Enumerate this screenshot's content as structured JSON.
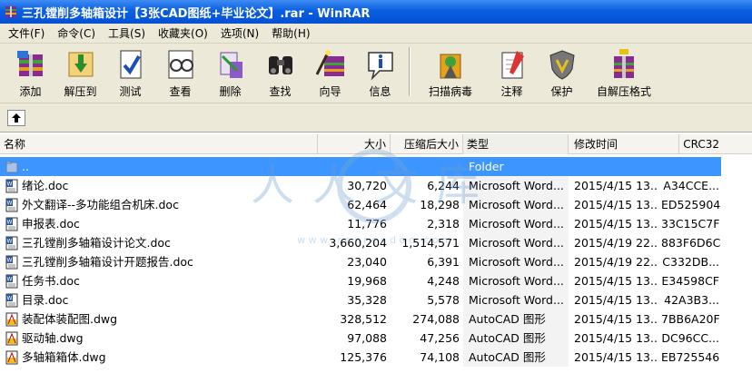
{
  "window": {
    "title": "三孔镗削多轴箱设计【3张CAD图纸+毕业论文】.rar - WinRAR"
  },
  "menu": [
    "文件(F)",
    "命令(C)",
    "工具(S)",
    "收藏夹(O)",
    "选项(N)",
    "帮助(H)"
  ],
  "toolbar": [
    {
      "label": "添加",
      "icon": "add-archive-icon"
    },
    {
      "label": "解压到",
      "icon": "extract-to-icon"
    },
    {
      "label": "测试",
      "icon": "test-icon"
    },
    {
      "label": "查看",
      "icon": "view-icon"
    },
    {
      "label": "删除",
      "icon": "delete-icon"
    },
    {
      "label": "查找",
      "icon": "find-icon"
    },
    {
      "label": "向导",
      "icon": "wizard-icon"
    },
    {
      "label": "信息",
      "icon": "info-icon"
    },
    {
      "label": "扫描病毒",
      "icon": "virus-scan-icon"
    },
    {
      "label": "注释",
      "icon": "comment-icon"
    },
    {
      "label": "保护",
      "icon": "protect-icon"
    },
    {
      "label": "自解压格式",
      "icon": "sfx-icon"
    }
  ],
  "columns": {
    "name": "名称",
    "size": "大小",
    "packed": "压缩后大小",
    "type": "类型",
    "modified": "修改时间",
    "crc": "CRC32"
  },
  "watermark": {
    "text": "人人文库",
    "url": "w w w . r e n r e n d o c . c o m"
  },
  "files": [
    {
      "name": "..",
      "size": "",
      "packed": "",
      "type": "Folder",
      "modified": "",
      "crc": "",
      "kind": "folder",
      "selected": true
    },
    {
      "name": "绪论.doc",
      "size": "30,720",
      "packed": "6,244",
      "type": "Microsoft Word...",
      "modified": "2015/4/15 13...",
      "crc": "A34CCE...",
      "kind": "doc"
    },
    {
      "name": "外文翻译--多功能组合机床.doc",
      "size": "62,464",
      "packed": "18,298",
      "type": "Microsoft Word...",
      "modified": "2015/4/15 13...",
      "crc": "ED525904",
      "kind": "doc"
    },
    {
      "name": "申报表.doc",
      "size": "11,776",
      "packed": "2,318",
      "type": "Microsoft Word...",
      "modified": "2015/4/15 13...",
      "crc": "33C15C7F",
      "kind": "doc"
    },
    {
      "name": "三孔镗削多轴箱设计论文.doc",
      "size": "3,660,204",
      "packed": "1,514,571",
      "type": "Microsoft Word...",
      "modified": "2015/4/19 22...",
      "crc": "883F6D6C",
      "kind": "doc"
    },
    {
      "name": "三孔镗削多轴箱设计开题报告.doc",
      "size": "23,040",
      "packed": "6,391",
      "type": "Microsoft Word...",
      "modified": "2015/4/19 22...",
      "crc": "C332DB...",
      "kind": "doc"
    },
    {
      "name": "任务书.doc",
      "size": "19,968",
      "packed": "4,248",
      "type": "Microsoft Word...",
      "modified": "2015/4/15 13...",
      "crc": "E34598CF",
      "kind": "doc"
    },
    {
      "name": "目录.doc",
      "size": "35,328",
      "packed": "5,578",
      "type": "Microsoft Word...",
      "modified": "2015/4/15 13...",
      "crc": "42A3B3...",
      "kind": "doc"
    },
    {
      "name": "装配体装配图.dwg",
      "size": "328,512",
      "packed": "274,088",
      "type": "AutoCAD 图形",
      "modified": "2015/4/15 13...",
      "crc": "7BB6A20F",
      "kind": "dwg"
    },
    {
      "name": "驱动轴.dwg",
      "size": "97,088",
      "packed": "47,256",
      "type": "AutoCAD 图形",
      "modified": "2015/4/15 13...",
      "crc": "DC96CC...",
      "kind": "dwg"
    },
    {
      "name": "多轴箱箱体.dwg",
      "size": "125,376",
      "packed": "74,108",
      "type": "AutoCAD 图形",
      "modified": "2015/4/15 13...",
      "crc": "EB725546",
      "kind": "dwg"
    }
  ]
}
